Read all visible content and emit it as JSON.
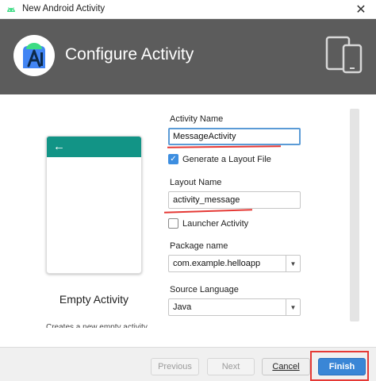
{
  "window": {
    "title": "New Android Activity",
    "close_symbol": "✕"
  },
  "header": {
    "title": "Configure Activity",
    "logo_icon": "android-studio-logo-icon",
    "device_icon": "tablet-phone-icon"
  },
  "template": {
    "name": "Empty Activity",
    "description": "Creates a new empty activity",
    "back_arrow": "←",
    "appbar_color": "#129486"
  },
  "form": {
    "activity_name_label": "Activity Name",
    "activity_name_value": "MessageActivity",
    "generate_layout_label": "Generate a Layout File",
    "generate_layout_checked": true,
    "layout_name_label": "Layout Name",
    "layout_name_value": "activity_message",
    "launcher_activity_label": "Launcher Activity",
    "launcher_activity_checked": false,
    "package_name_label": "Package name",
    "package_name_value": "com.example.helloapp",
    "source_language_label": "Source Language",
    "source_language_value": "Java",
    "check_mark": "✓",
    "dropdown_arrow": "▼"
  },
  "buttons": {
    "previous": "Previous",
    "next": "Next",
    "cancel": "Cancel",
    "finish": "Finish"
  },
  "colors": {
    "header_bg": "#5c5c5c",
    "accent": "#3a86d6",
    "highlight": "#e53935"
  }
}
